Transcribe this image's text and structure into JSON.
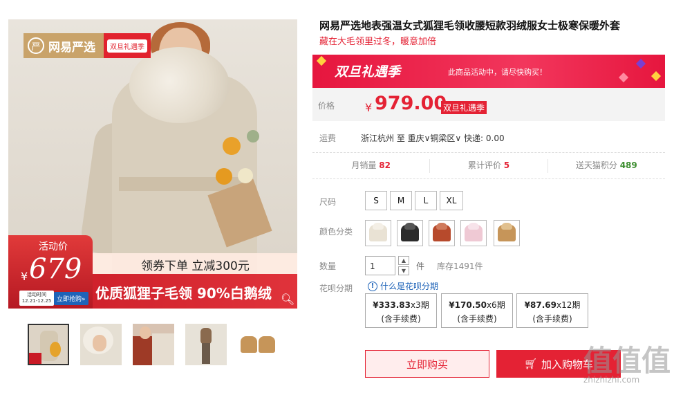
{
  "product": {
    "title": "网易严选地表强温女式狐狸毛领收腰短款羽绒服女士极寒保暖外套",
    "subtitle": "藏在大毛领里过冬，暖意加倍"
  },
  "main_image": {
    "brand_logo_text": "网易严选",
    "festival_badge": "双旦礼遇季",
    "promo_label": "活动价",
    "promo_currency": "¥",
    "promo_price": "679",
    "promo_date": "活动时间 12.21-12.25",
    "promo_grab": "立即抢购»",
    "coupon_text": "领券下单 立减300元",
    "banner_text": "优质狐狸子毛领 90%白鹅绒"
  },
  "thumbnails": [
    {
      "name": "thumb-1",
      "active": true
    },
    {
      "name": "thumb-2",
      "active": false
    },
    {
      "name": "thumb-3",
      "active": false
    },
    {
      "name": "thumb-4",
      "active": false
    },
    {
      "name": "thumb-5",
      "active": false
    }
  ],
  "banner": {
    "logo": "双旦礼遇季",
    "message": "此商品活动中，请尽快购买！"
  },
  "price": {
    "label": "价格",
    "currency": "¥",
    "value": "979.00",
    "tag": "双旦礼遇季"
  },
  "shipping": {
    "label": "运费",
    "value": "浙江杭州  至  重庆∨铜梁区∨  快递: 0.00"
  },
  "stats": {
    "monthly_sales_label": "月销量",
    "monthly_sales": "82",
    "reviews_label": "累计评价",
    "reviews": "5",
    "points_label": "送天猫积分",
    "points": "489"
  },
  "options": {
    "size_label": "尺码",
    "sizes": [
      "S",
      "M",
      "L",
      "XL"
    ],
    "color_label": "颜色分类",
    "colors": [
      "#e9e2d4",
      "#2b2b2b",
      "#b74a2c",
      "#efc9d4",
      "#c69559"
    ],
    "quantity_label": "数量",
    "quantity": "1",
    "quantity_unit": "件",
    "stock": "库存1491件",
    "huabei_label": "花呗分期",
    "huabei_help": "什么是花呗分期",
    "installments": [
      {
        "amount": "¥333.83",
        "period": "x3期",
        "note": "(含手续费)"
      },
      {
        "amount": "¥170.50",
        "period": "x6期",
        "note": "(含手续费)"
      },
      {
        "amount": "¥87.69",
        "period": "x12期",
        "note": "(含手续费)"
      }
    ]
  },
  "actions": {
    "buy_now": "立即购买",
    "add_cart": "加入购物车"
  },
  "watermark": {
    "logo": "值值值",
    "url": "zhizhizhi.com"
  },
  "colors": {
    "accent": "#e42234",
    "banner": "#f2365c",
    "link": "#1e63b8"
  }
}
